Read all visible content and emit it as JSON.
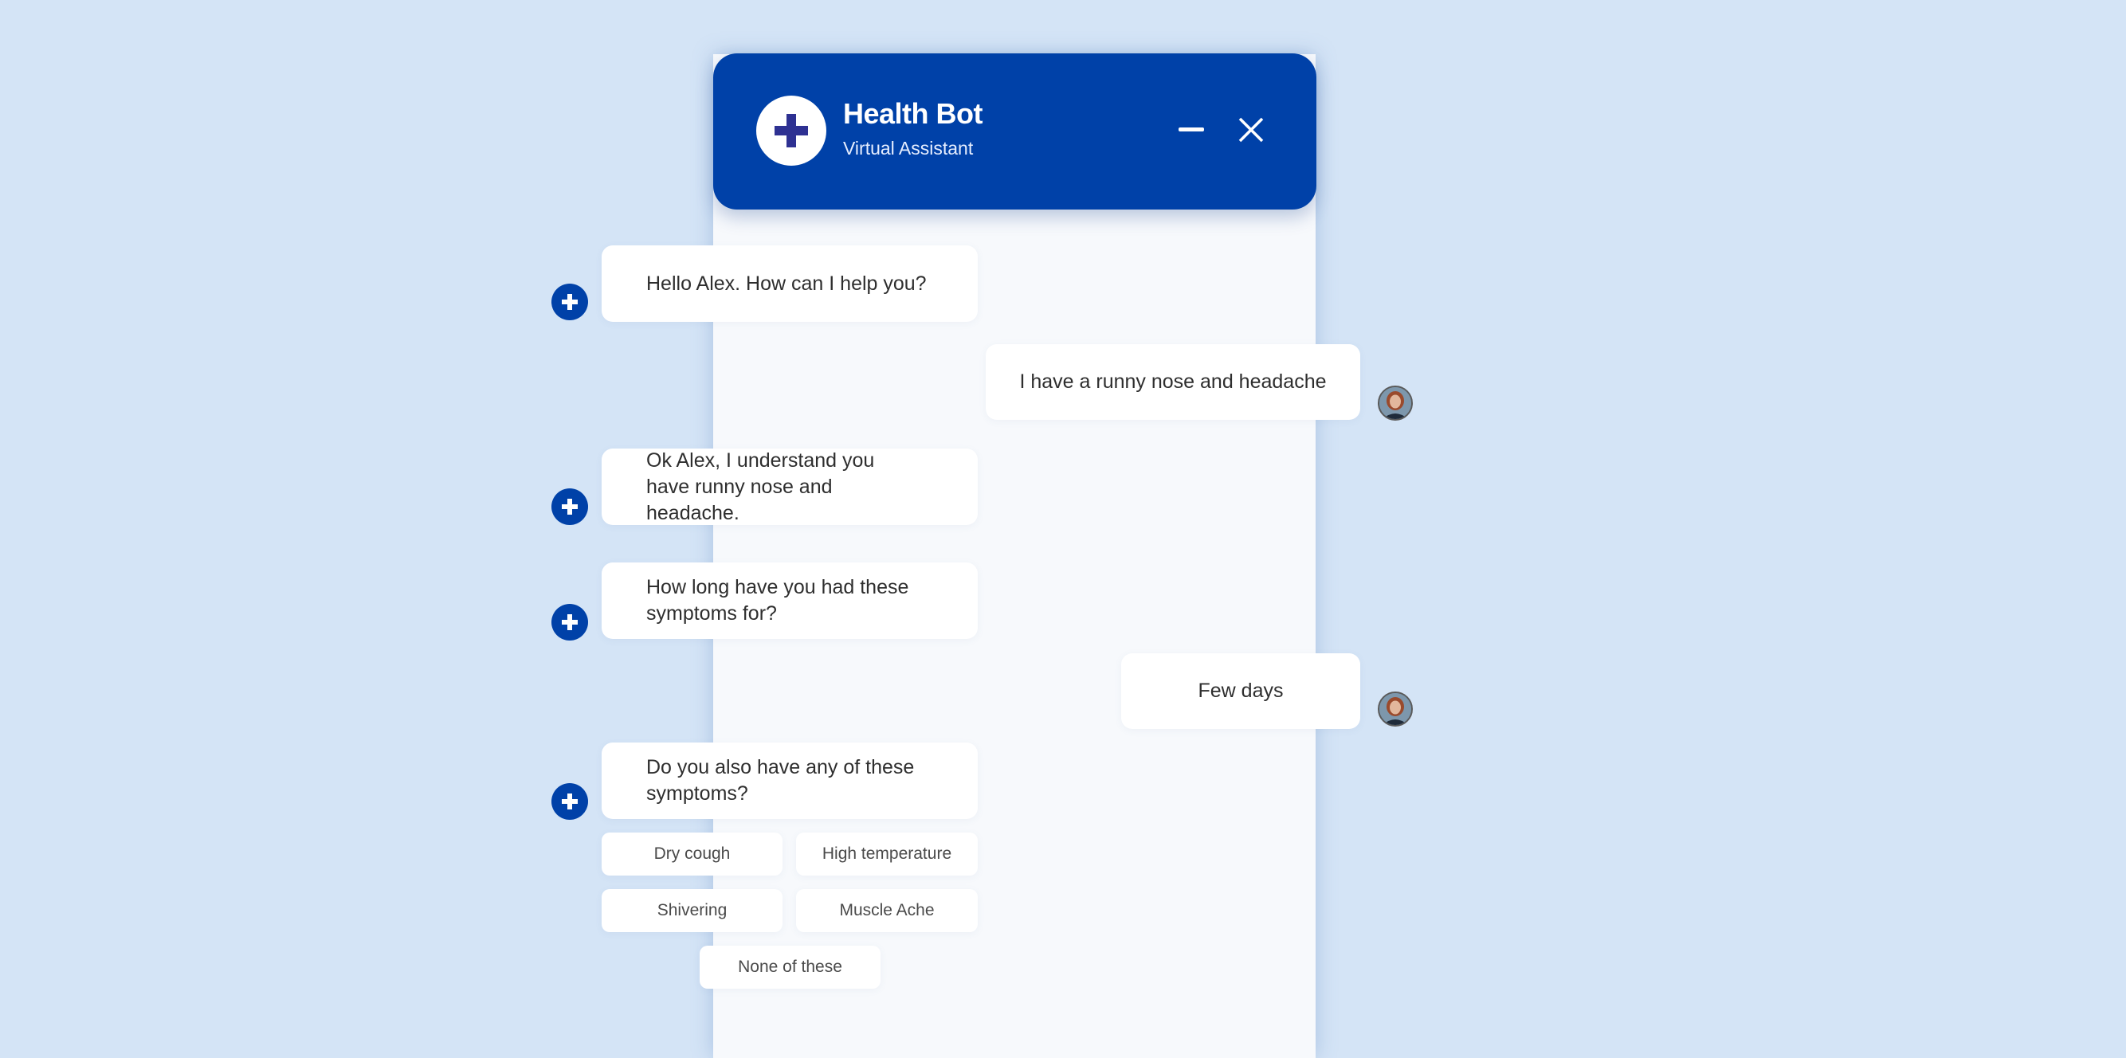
{
  "header": {
    "title": "Health Bot",
    "subtitle": "Virtual Assistant",
    "avatar_icon": "medical-cross-icon",
    "minimize_icon": "minimize-icon",
    "close_icon": "close-icon"
  },
  "colors": {
    "brand": "#0041a8",
    "header_cross": "#2e3192",
    "background": "#d4e4f6",
    "panel": "#f7f9fc"
  },
  "messages": [
    {
      "sender": "bot",
      "text": "Hello Alex. How can I help you?"
    },
    {
      "sender": "user",
      "text": "I have a runny nose and headache"
    },
    {
      "sender": "bot",
      "text": "Ok Alex, I understand you have runny nose and headache."
    },
    {
      "sender": "bot",
      "text": "How long have you had these symptoms for?"
    },
    {
      "sender": "user",
      "text": "Few days"
    },
    {
      "sender": "bot",
      "text": "Do you also have any of these symptoms?"
    }
  ],
  "quick_replies": [
    {
      "label": "Dry cough"
    },
    {
      "label": "High temperature"
    },
    {
      "label": "Shivering"
    },
    {
      "label": "Muscle Ache"
    },
    {
      "label": "None of these"
    }
  ]
}
